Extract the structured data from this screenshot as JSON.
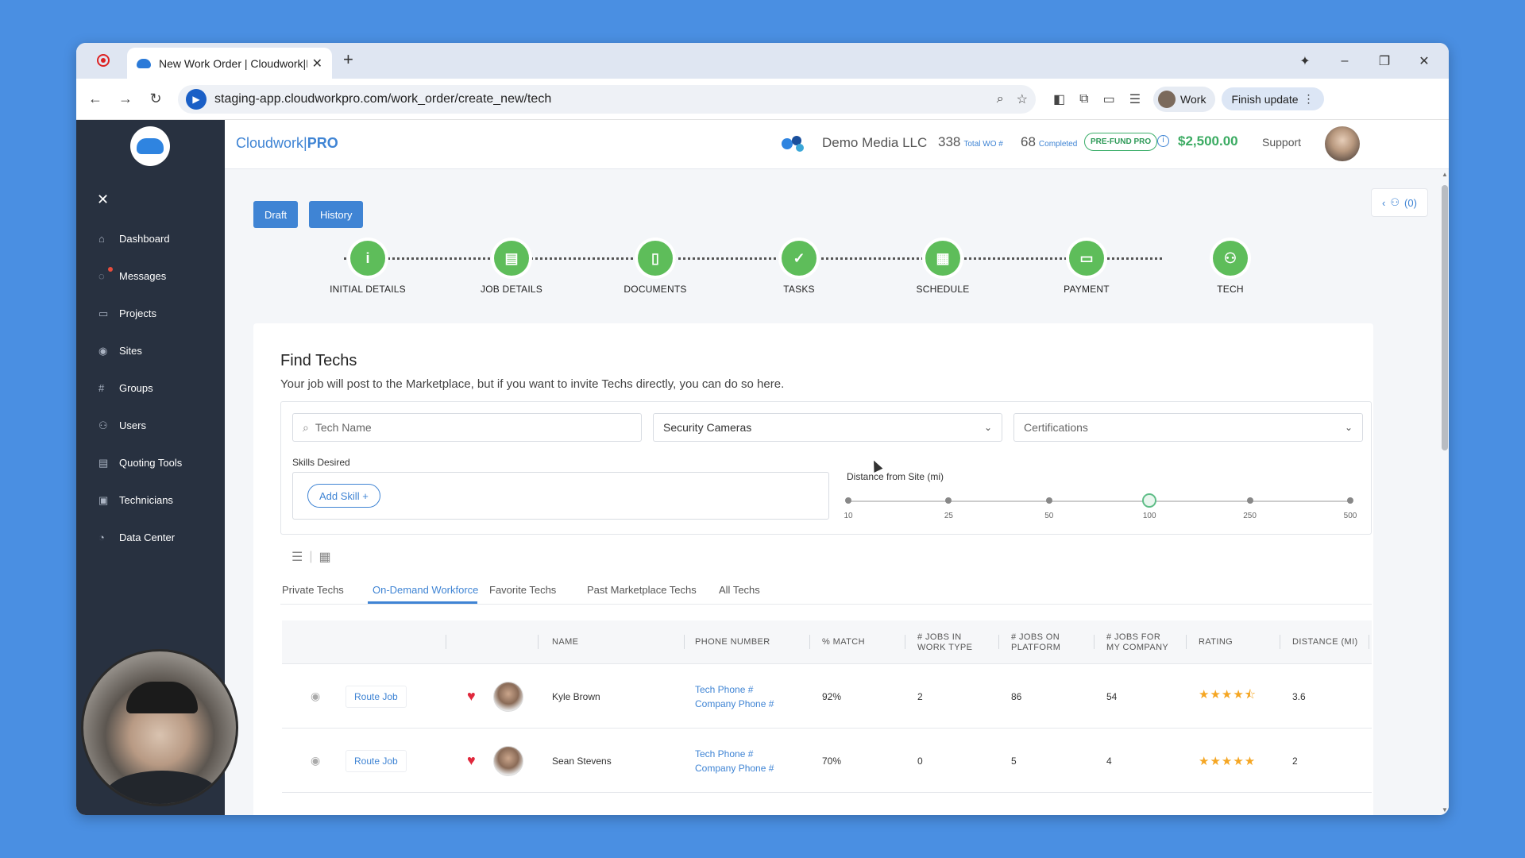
{
  "browser": {
    "tab_title": "New Work Order | Cloudwork|P",
    "new_tab_icon": "+",
    "url": "staging-app.cloudworkpro.com/work_order/create_new/tech",
    "profile_label": "Work",
    "update_label": "Finish update"
  },
  "sidebar": {
    "items": [
      {
        "label": "Dashboard",
        "icon": "home-icon"
      },
      {
        "label": "Messages",
        "icon": "chat-icon"
      },
      {
        "label": "Projects",
        "icon": "folder-icon"
      },
      {
        "label": "Sites",
        "icon": "pin-icon"
      },
      {
        "label": "Groups",
        "icon": "hash-icon"
      },
      {
        "label": "Users",
        "icon": "users-icon"
      },
      {
        "label": "Quoting Tools",
        "icon": "calculator-icon"
      },
      {
        "label": "Technicians",
        "icon": "id-card-icon"
      },
      {
        "label": "Data Center",
        "icon": "pie-chart-icon"
      }
    ]
  },
  "header": {
    "brand_main": "Cloudwork",
    "brand_sep": "|",
    "brand_pro": "PRO",
    "company": "Demo Media LLC",
    "total_wo_value": "338",
    "total_wo_label": "Total WO #",
    "completed_value": "68",
    "completed_label": "Completed",
    "prefund_label": "PRE-FUND PRO",
    "info_glyph": "i",
    "balance": "$2,500.00",
    "support": "Support"
  },
  "toolbar": {
    "draft_label": "Draft",
    "history_label": "History",
    "team_count": "(0)"
  },
  "steps": [
    {
      "label": "INITIAL DETAILS",
      "icon": "info-icon",
      "glyph": "i"
    },
    {
      "label": "JOB DETAILS",
      "icon": "clipboard-icon",
      "glyph": "▤"
    },
    {
      "label": "DOCUMENTS",
      "icon": "document-icon",
      "glyph": "▯"
    },
    {
      "label": "TASKS",
      "icon": "checklist-icon",
      "glyph": "✓"
    },
    {
      "label": "SCHEDULE",
      "icon": "calendar-icon",
      "glyph": "▦"
    },
    {
      "label": "PAYMENT",
      "icon": "payment-icon",
      "glyph": "▭"
    },
    {
      "label": "TECH",
      "icon": "people-icon",
      "glyph": "⚇"
    }
  ],
  "find": {
    "title": "Find Techs",
    "subtitle": "Your job will post to the Marketplace, but if you want to invite Techs directly, you can do so here.",
    "tech_name_placeholder": "Tech Name",
    "work_type_value": "Security Cameras",
    "certifications_placeholder": "Certifications",
    "skills_label": "Skills Desired",
    "add_skill_label": "Add Skill +",
    "distance_label": "Distance from Site (mi)",
    "distance_options": [
      "10",
      "25",
      "50",
      "100",
      "250",
      "500"
    ],
    "distance_selected": "100"
  },
  "tabs": [
    {
      "label": "Private Techs",
      "active": false
    },
    {
      "label": "On-Demand Workforce",
      "active": true
    },
    {
      "label": "Favorite Techs",
      "active": false
    },
    {
      "label": "Past Marketplace Techs",
      "active": false
    },
    {
      "label": "All Techs",
      "active": false
    }
  ],
  "table": {
    "columns": {
      "name": "NAME",
      "phone": "PHONE NUMBER",
      "match": "% MATCH",
      "jobs_work_type_1": "# JOBS IN",
      "jobs_work_type_2": "WORK TYPE",
      "jobs_platform_1": "# JOBS ON",
      "jobs_platform_2": "PLATFORM",
      "jobs_company_1": "# JOBS FOR",
      "jobs_company_2": "MY COMPANY",
      "rating": "RATING",
      "distance": "DISTANCE (MI)"
    },
    "rows": [
      {
        "route_label": "Route Job",
        "name": "Kyle Brown",
        "tech_phone": "Tech Phone #",
        "company_phone": "Company Phone #",
        "match": "92%",
        "jobs_work_type": "2",
        "jobs_platform": "86",
        "jobs_company": "54",
        "rating": 4.5,
        "stars": "★★★★⯪",
        "distance": "3.6"
      },
      {
        "route_label": "Route Job",
        "name": "Sean Stevens",
        "tech_phone": "Tech Phone #",
        "company_phone": "Company Phone #",
        "match": "70%",
        "jobs_work_type": "0",
        "jobs_platform": "5",
        "jobs_company": "4",
        "rating": 5,
        "stars": "★★★★★",
        "distance": "2"
      }
    ]
  },
  "colors": {
    "accent": "#3f84d4",
    "sidebar": "#283140",
    "step_green": "#5ebd5a",
    "balance_green": "#3bab62",
    "heart": "#e0283c",
    "star": "#f5a623"
  }
}
